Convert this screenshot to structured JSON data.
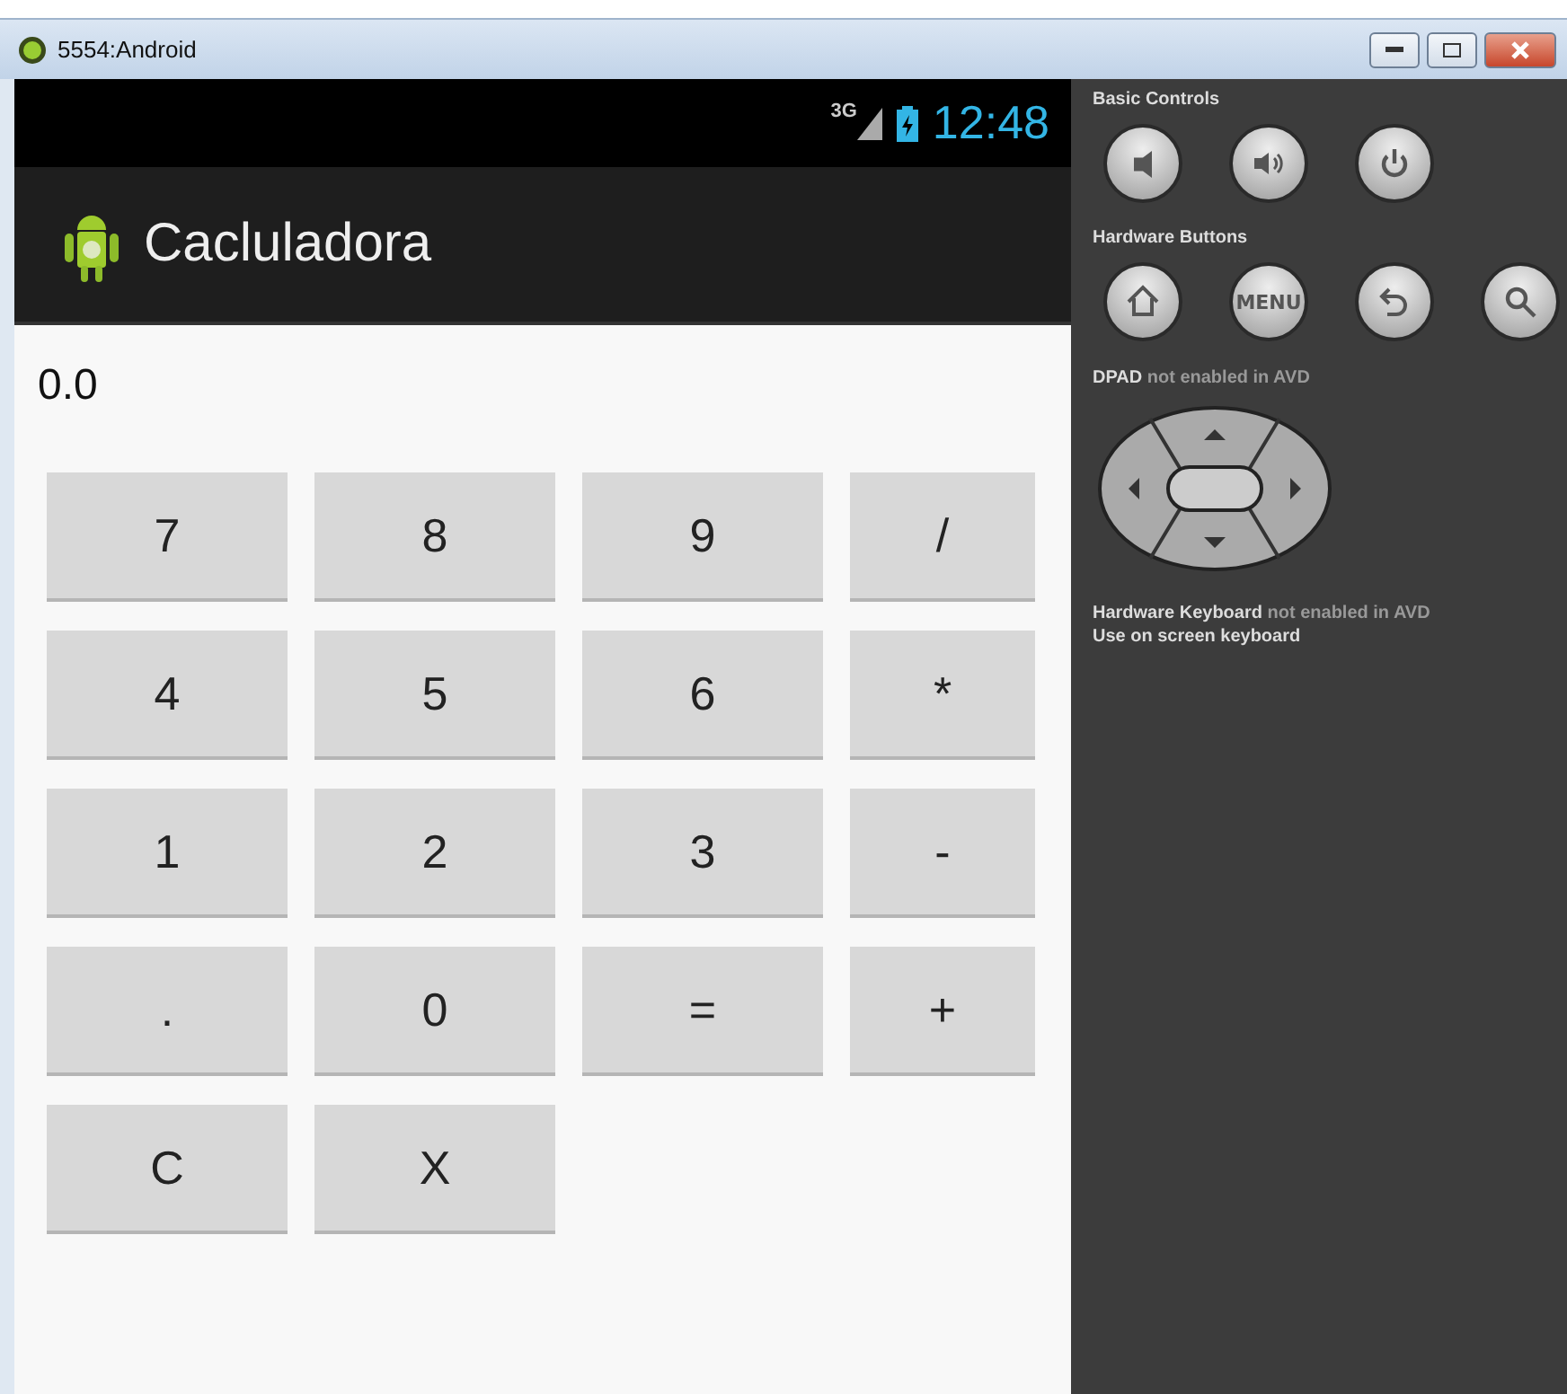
{
  "window": {
    "title": "5554:Android"
  },
  "status_bar": {
    "network": "3G",
    "time": "12:48"
  },
  "app_bar": {
    "title": "Cacluladora"
  },
  "display": "0.0",
  "keys": [
    [
      "7",
      "8",
      "9",
      "/"
    ],
    [
      "4",
      "5",
      "6",
      "*"
    ],
    [
      "1",
      "2",
      "3",
      "-"
    ],
    [
      ".",
      "0",
      "=",
      "+"
    ],
    [
      "C",
      "X"
    ]
  ],
  "controls": {
    "basic_title": "Basic Controls",
    "hardware_title": "Hardware Buttons",
    "menu_label": "MENU",
    "dpad_title": "DPAD",
    "dpad_note": "not enabled in AVD",
    "keyboard_title": "Hardware Keyboard",
    "keyboard_note": "not enabled in AVD",
    "keyboard_hint": "Use on screen keyboard"
  }
}
